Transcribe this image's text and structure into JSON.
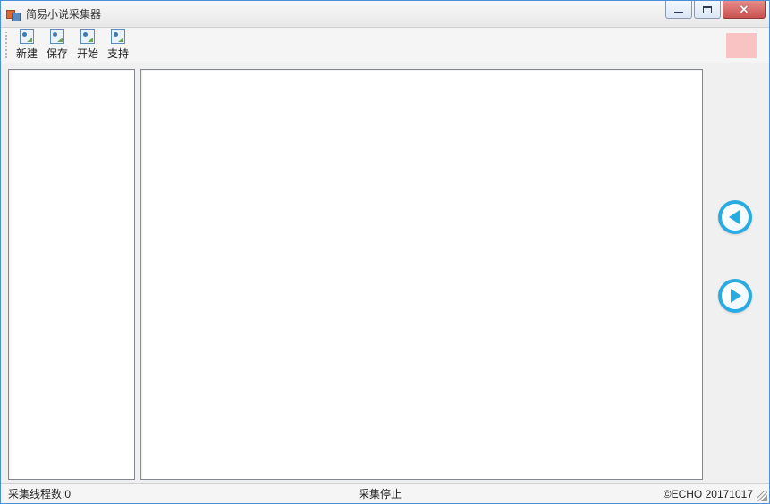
{
  "window": {
    "title": "简易小说采集器"
  },
  "toolbar": {
    "items": [
      {
        "label": "新建"
      },
      {
        "label": "保存"
      },
      {
        "label": "开始"
      },
      {
        "label": "支持"
      }
    ]
  },
  "statusbar": {
    "threads_label": "采集线程数:0",
    "status_text": "采集停止",
    "copyright": "©ECHO 20171017"
  }
}
